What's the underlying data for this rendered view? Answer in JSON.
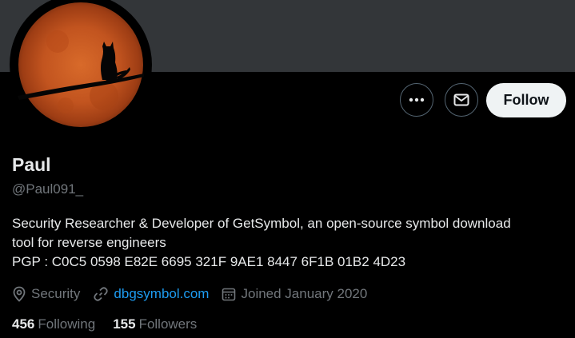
{
  "profile": {
    "name": "Paul",
    "handle": "@Paul091_",
    "bio_lines": [
      "Security Researcher & Developer of GetSymbol, an open-source symbol download",
      "tool for reverse engineers",
      "PGP : C0C5 0598 E82E 6695 321F 9AE1 8447 6F1B 01B2 4D23"
    ],
    "location": "Security",
    "website": "dbgsymbol.com",
    "joined": "Joined January 2020"
  },
  "actions": {
    "more_icon": "more-horizontal-icon",
    "message_icon": "envelope-icon",
    "follow_label": "Follow"
  },
  "stats": {
    "following_count": "456",
    "following_label": "Following",
    "followers_count": "155",
    "followers_label": "Followers"
  },
  "colors": {
    "banner": "#333639",
    "background": "#000000",
    "link": "#1d9bf0",
    "muted": "#71767b",
    "text": "#e7e9ea",
    "follow_bg": "#eff3f4"
  }
}
